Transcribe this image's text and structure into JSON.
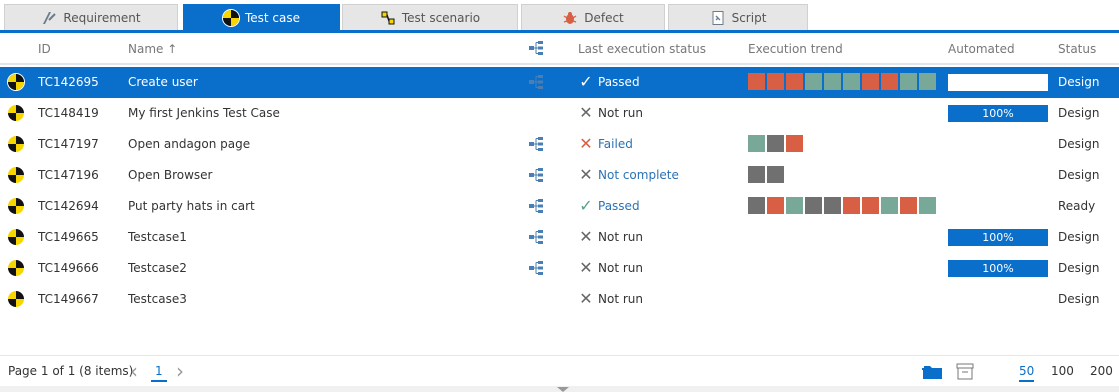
{
  "tabs": [
    {
      "label": "Requirement",
      "icon": "requirement-icon",
      "active": false
    },
    {
      "label": "Test case",
      "icon": "test-case-icon",
      "active": true
    },
    {
      "label": "Test scenario",
      "icon": "test-scenario-icon",
      "active": false
    },
    {
      "label": "Defect",
      "icon": "defect-bug-icon",
      "active": false
    },
    {
      "label": "Script",
      "icon": "script-icon",
      "active": false
    }
  ],
  "columns": {
    "id": "ID",
    "name": "Name",
    "sort_indicator": "↑",
    "last_status": "Last execution status",
    "trend": "Execution trend",
    "automated": "Automated",
    "status": "Status"
  },
  "rows": [
    {
      "id": "TC142695",
      "name": "Create user",
      "tree": true,
      "last_status": "Passed",
      "trend": [
        "r",
        "r",
        "r",
        "g",
        "g",
        "g",
        "r",
        "r",
        "g",
        "g"
      ],
      "automated": "",
      "status": "Design",
      "selected": true
    },
    {
      "id": "TC148419",
      "name": "My first Jenkins Test Case",
      "tree": false,
      "last_status": "Not run",
      "trend": [],
      "automated": "100%",
      "status": "Design"
    },
    {
      "id": "TC147197",
      "name": "Open andagon page",
      "tree": true,
      "last_status": "Failed",
      "trend": [
        "g",
        "d",
        "r"
      ],
      "automated": null,
      "status": "Design"
    },
    {
      "id": "TC147196",
      "name": "Open Browser",
      "tree": true,
      "last_status": "Not complete",
      "trend": [
        "d",
        "d"
      ],
      "automated": null,
      "status": "Design"
    },
    {
      "id": "TC142694",
      "name": "Put party hats in cart",
      "tree": true,
      "last_status": "Passed",
      "trend": [
        "d",
        "r",
        "g",
        "d",
        "d",
        "r",
        "r",
        "g",
        "r",
        "g"
      ],
      "automated": null,
      "status": "Ready"
    },
    {
      "id": "TC149665",
      "name": "Testcase1",
      "tree": true,
      "last_status": "Not run",
      "trend": [],
      "automated": "100%",
      "status": "Design"
    },
    {
      "id": "TC149666",
      "name": "Testcase2",
      "tree": true,
      "last_status": "Not run",
      "trend": [],
      "automated": "100%",
      "status": "Design"
    },
    {
      "id": "TC149667",
      "name": "Testcase3",
      "tree": false,
      "last_status": "Not run",
      "trend": [],
      "automated": null,
      "status": "Design"
    }
  ],
  "footer": {
    "page_info": "Page 1 of 1 (8 items)",
    "prev": "‹",
    "current_page": "1",
    "next": "›",
    "page_sizes": [
      "50",
      "100",
      "200"
    ],
    "active_size": "50"
  },
  "colors": {
    "accent": "#0a6fcb",
    "trend_red": "#d95f44",
    "trend_green": "#78a898",
    "trend_dark": "#707070"
  }
}
